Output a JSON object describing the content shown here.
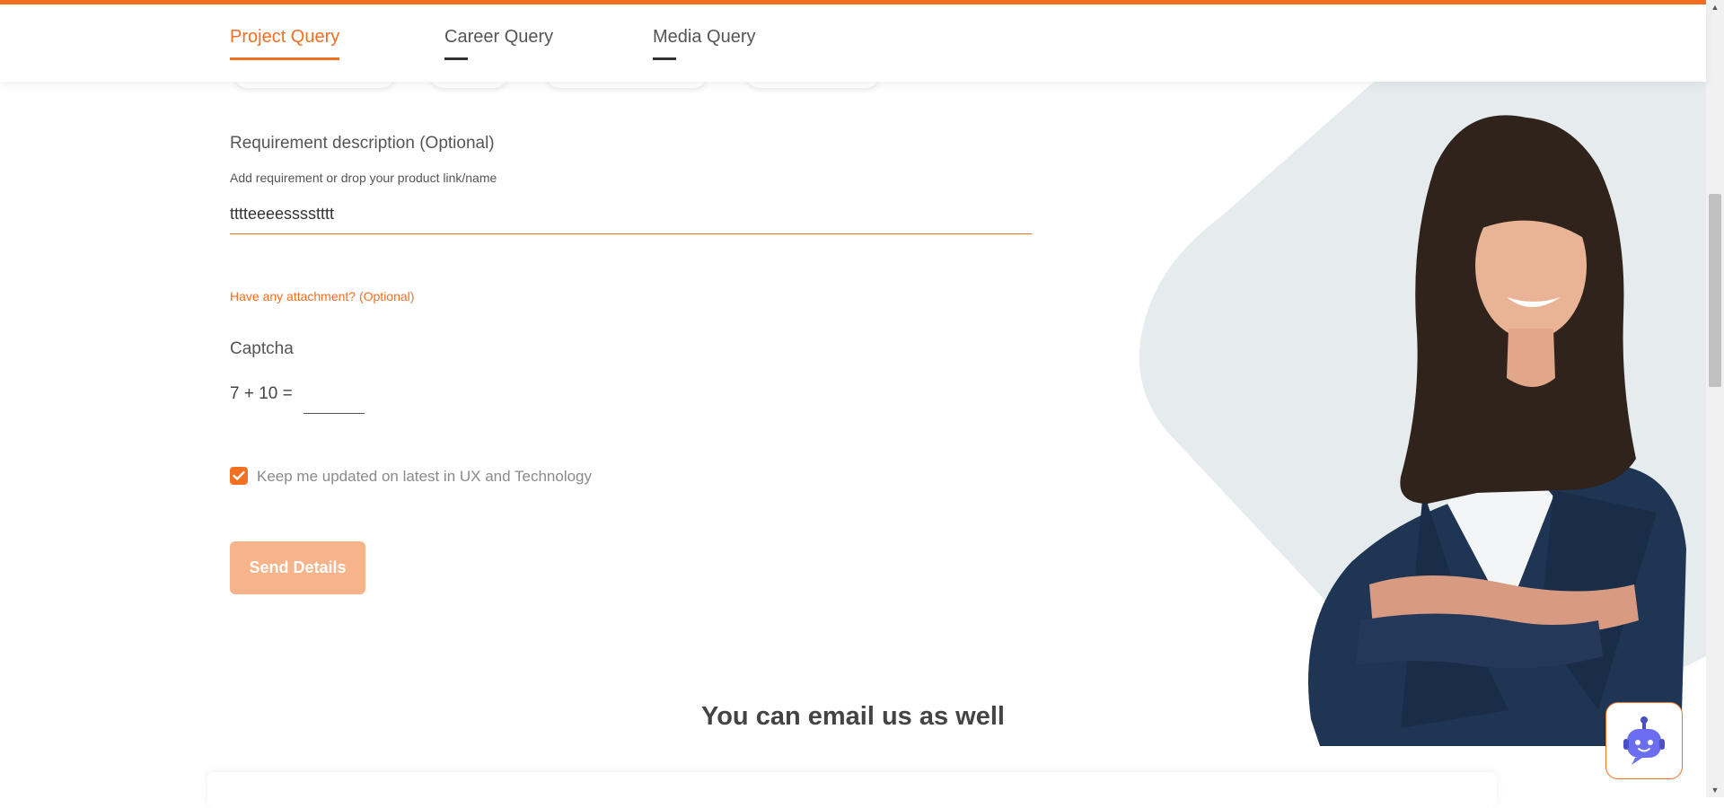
{
  "tabs": [
    {
      "label": "Project Query",
      "active": true
    },
    {
      "label": "Career Query",
      "active": false
    },
    {
      "label": "Media Query",
      "active": false
    }
  ],
  "form": {
    "requirement_title": "Requirement description (Optional)",
    "requirement_hint": "Add requirement or drop your product link/name",
    "requirement_value": "tttteeeesssstttt",
    "attachment_link": "Have any attachment? (Optional)",
    "captcha_label": "Captcha",
    "captcha_question": "7 + 10  =",
    "captcha_value": "",
    "newsletter_label": "Keep me updated on latest in UX and Technology",
    "newsletter_checked": true,
    "submit_label": "Send Details"
  },
  "email_section": {
    "heading": "You can email us as well"
  },
  "colors": {
    "accent": "#f36f21",
    "button_disabled": "#f7b389",
    "hero_shape": "#e6ecee",
    "blazer": "#1f3554"
  },
  "icons": {
    "checkbox": "check-icon",
    "chat": "chatbot-icon"
  }
}
